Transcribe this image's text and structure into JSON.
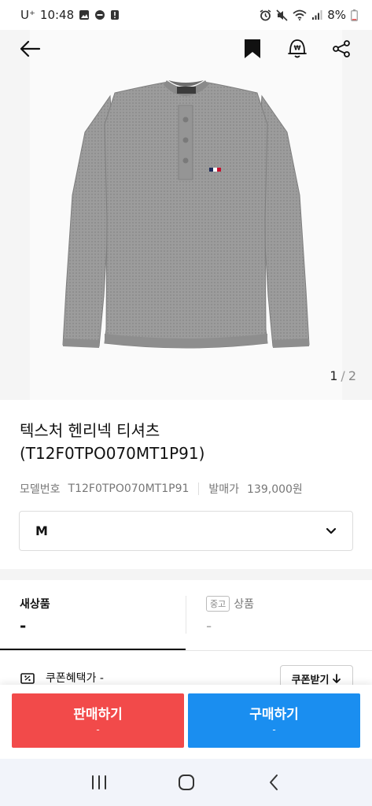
{
  "status_bar": {
    "carrier": "U⁺",
    "time": "10:48",
    "battery": "8%"
  },
  "gallery": {
    "current_page": "1",
    "separator": "/",
    "total_pages": "2"
  },
  "product": {
    "title": "텍스처 헨리넥 티셔츠 (T12F0TPO070MT1P91)",
    "model_label": "모델번호",
    "model_value": "T12F0TPO070MT1P91",
    "release_price_label": "발매가",
    "release_price_value": "139,000원"
  },
  "size_select": {
    "value": "M"
  },
  "tabs": {
    "new": {
      "label": "새상품",
      "price": "-"
    },
    "used": {
      "badge": "중고",
      "label": "상품",
      "price": "-"
    }
  },
  "coupon": {
    "text": "쿠폰혜택가 -",
    "button_label": "쿠폰받기"
  },
  "actions": {
    "sell": {
      "label": "판매하기",
      "sub": "-"
    },
    "buy": {
      "label": "구매하기",
      "sub": "-"
    }
  },
  "colors": {
    "sell": "#f24a4a",
    "buy": "#1a8ef0",
    "shirt": "#9a9a9a"
  },
  "icons": [
    "back-arrow-icon",
    "bookmark-icon",
    "price-alert-icon",
    "share-icon",
    "chevron-down-icon",
    "coupon-icon",
    "download-icon",
    "recent-apps-icon",
    "home-icon",
    "back-icon"
  ]
}
